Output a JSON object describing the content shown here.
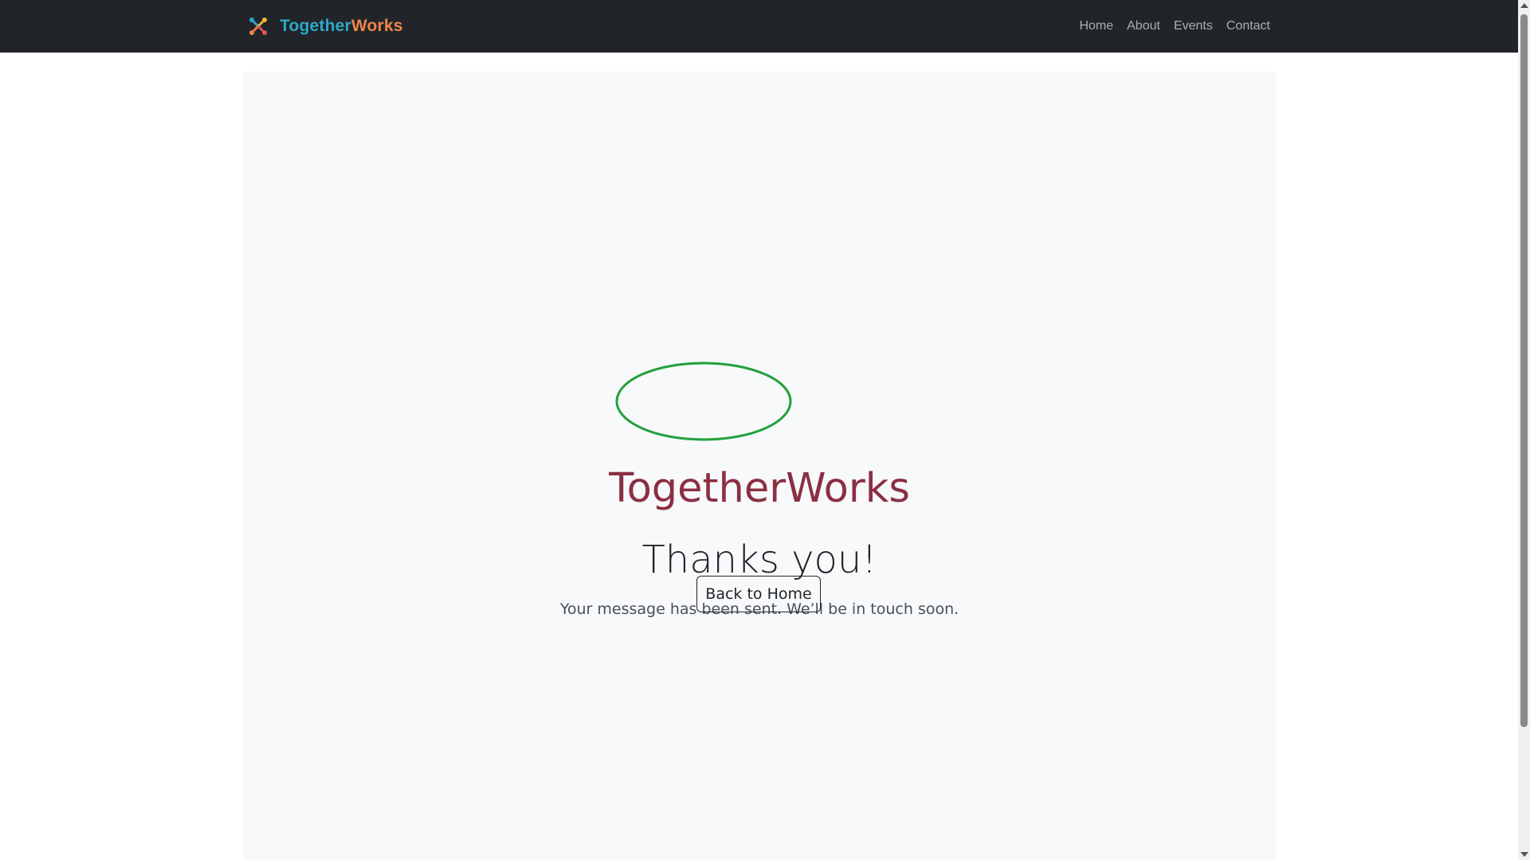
{
  "navbar": {
    "brand_part1": "Together",
    "brand_part2": "Works",
    "links": [
      "Home",
      "About",
      "Events",
      "Contact"
    ]
  },
  "hero": {
    "logo_text": "TogetherWorks",
    "title": "Thanks you!",
    "subtitle": "Your message has been sent. We’ll be in touch soon.",
    "button_label": "Back to Home"
  },
  "colors": {
    "navbar_bg": "#212529",
    "brand_together": "#2ea8c8",
    "brand_works": "#f0834a",
    "logo_text": "#8b2f43",
    "annotation_circle": "#22a03c",
    "content_bg": "#f8f9fa"
  },
  "icons": {
    "brand": "people-circle-logo-icon",
    "scroll_up": "scroll-up-arrow-icon",
    "scroll_down": "scroll-down-arrow-icon"
  }
}
